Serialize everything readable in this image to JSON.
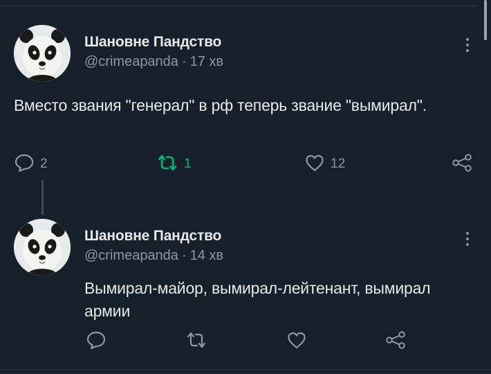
{
  "tweets": [
    {
      "display_name": "Шановне Пандство",
      "handle": "@crimeapanda",
      "separator": "·",
      "time": "17 хв",
      "text": "Вместо звания \"генерал\" в рф теперь звание \"вымирал\".",
      "actions": {
        "reply_count": "2",
        "retweet_count": "1",
        "like_count": "12"
      },
      "retweeted": true
    },
    {
      "display_name": "Шановне Пандство",
      "handle": "@crimeapanda",
      "separator": "·",
      "time": "14 хв",
      "text": "Вымирал-майор, вымирал-лейтенант, вымирал армии",
      "actions": {
        "reply_count": "",
        "retweet_count": "",
        "like_count": ""
      },
      "retweeted": false
    }
  ],
  "colors": {
    "background": "#15202b",
    "text": "#e7e9ea",
    "secondary_text": "#8b98a5",
    "retweet_active": "#00ba7c"
  },
  "icons": [
    "reply-icon",
    "retweet-icon",
    "like-icon",
    "share-icon",
    "more-options-icon"
  ]
}
